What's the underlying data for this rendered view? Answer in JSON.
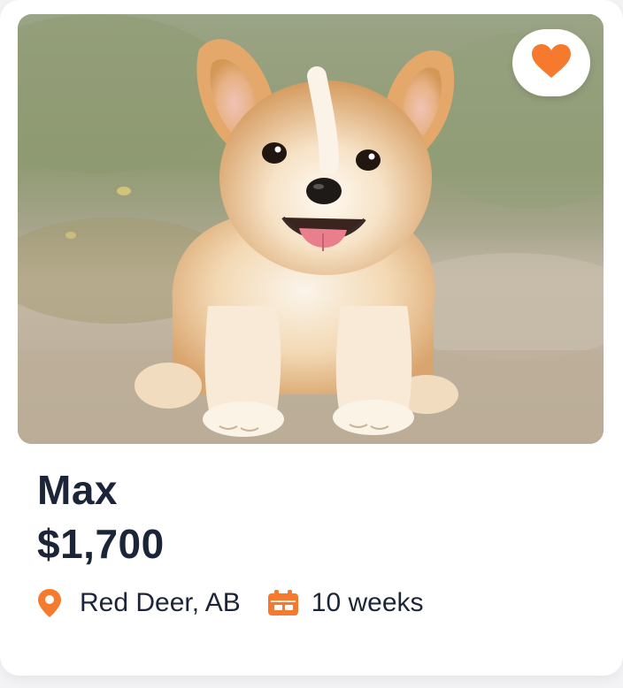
{
  "listing": {
    "name": "Max",
    "price": "$1,700",
    "location": "Red Deer, AB",
    "age": "10 weeks",
    "photo_subject": "corgi puppy sitting on a dirt path",
    "favorite": true
  },
  "icons": {
    "favorite": "heart-icon",
    "location": "location-pin-icon",
    "age": "calendar-icon"
  },
  "colors": {
    "accent": "#f57a2e",
    "text": "#1c2538",
    "card": "#ffffff"
  }
}
